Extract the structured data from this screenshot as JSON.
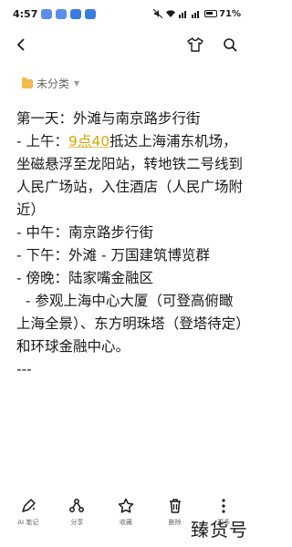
{
  "status_bar": {
    "time": "4:57",
    "battery": "71%"
  },
  "folder": {
    "label": "未分类"
  },
  "note": {
    "cut_line": " "
  },
  "lines": [
    "第一天：外滩与南京路步行街",
    "- 上午：",
    "9点40",
    "抵达上海浦东机场，坐磁悬浮至龙阳站，转地铁二号线到人民广场站，入住酒店（人民广场附近）",
    "- 中午：南京路步行街",
    "- 下午：外滩 - 万国建筑博览群",
    "- 傍晚：陆家嘴金融区",
    "  - 参观上海中心大厦（可登高俯瞰上海全景）、东方明珠塔（登塔待定）和环球金融中心。",
    "---"
  ],
  "toolbar": {
    "ai_note": "AI 笔记",
    "share": "分享",
    "collect": "收藏",
    "delete": "删除",
    "more": "更多"
  },
  "watermark": "臻货号",
  "colors": {
    "highlight": "#d9a500",
    "folder": "#f2b94b"
  }
}
